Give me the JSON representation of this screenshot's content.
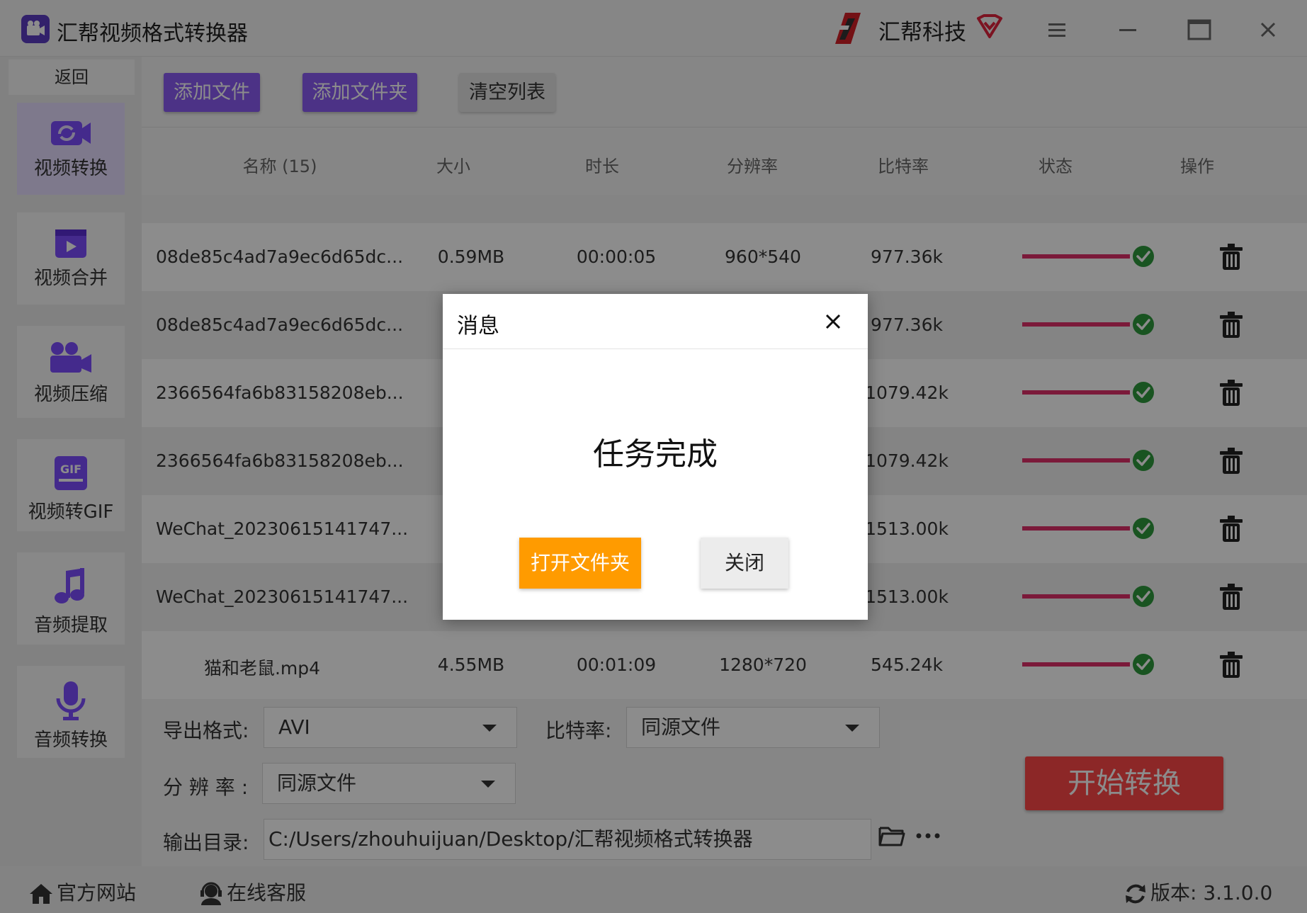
{
  "window": {
    "title": "汇帮视频格式转换器",
    "brand": "汇帮科技",
    "icons": [
      "app-logo-icon",
      "brand-logo-icon",
      "vip-icon",
      "menu-icon",
      "minimize-icon",
      "maximize-icon",
      "close-icon"
    ]
  },
  "sidebar": {
    "back_label": "返回",
    "items": [
      {
        "label": "视频转换",
        "icon": "video-convert-icon",
        "active": true
      },
      {
        "label": "视频合并",
        "icon": "video-merge-icon",
        "active": false
      },
      {
        "label": "视频压缩",
        "icon": "video-compress-icon",
        "active": false
      },
      {
        "label": "视频转GIF",
        "icon": "gif-icon",
        "active": false
      },
      {
        "label": "音频提取",
        "icon": "music-note-icon",
        "active": false
      },
      {
        "label": "音频转换",
        "icon": "microphone-icon",
        "active": false
      }
    ]
  },
  "toolbar": {
    "add_file": "添加文件",
    "add_folder": "添加文件夹",
    "clear_list": "清空列表"
  },
  "table": {
    "headers": {
      "name": "名称 (15)",
      "size": "大小",
      "duration": "时长",
      "resolution": "分辨率",
      "bitrate": "比特率",
      "status": "状态",
      "action": "操作"
    },
    "rows": [
      {
        "name": "08de85c4ad7a9ec6d65dc...",
        "size": "0.59MB",
        "duration": "00:00:05",
        "resolution": "960*540",
        "bitrate": "977.36k",
        "progress": 1.0
      },
      {
        "name": "08de85c4ad7a9ec6d65dc...",
        "size": "",
        "duration": "",
        "resolution": "",
        "bitrate": "977.36k",
        "progress": 1.0
      },
      {
        "name": "2366564fa6b83158208eb...",
        "size": "",
        "duration": "",
        "resolution": "",
        "bitrate": "1079.42k",
        "progress": 1.0
      },
      {
        "name": "2366564fa6b83158208eb...",
        "size": "",
        "duration": "",
        "resolution": "",
        "bitrate": "1079.42k",
        "progress": 1.0
      },
      {
        "name": "WeChat_20230615141747...",
        "size": "",
        "duration": "",
        "resolution": "",
        "bitrate": "1513.00k",
        "progress": 1.0
      },
      {
        "name": "WeChat_20230615141747...",
        "size": "",
        "duration": "",
        "resolution": "",
        "bitrate": "1513.00k",
        "progress": 1.0
      },
      {
        "name": "猫和老鼠.mp4",
        "size": "4.55MB",
        "duration": "00:01:09",
        "resolution": "1280*720",
        "bitrate": "545.24k",
        "progress": 1.0
      }
    ]
  },
  "settings": {
    "format_label": "导出格式:",
    "format_value": "AVI",
    "bitrate_label": "比特率:",
    "bitrate_value": "同源文件",
    "resolution_label": "分 辨 率 :",
    "resolution_value": "同源文件",
    "output_label": "输出目录:",
    "output_path": "C:/Users/zhouhuijuan/Desktop/汇帮视频格式转换器",
    "start_button": "开始转换"
  },
  "statusbar": {
    "website": "官方网站",
    "support": "在线客服",
    "version": "版本: 3.1.0.0"
  },
  "dialog": {
    "title": "消息",
    "message": "任务完成",
    "open_folder": "打开文件夹",
    "close": "关闭"
  },
  "colors": {
    "accent_purple": "#8a5cf5",
    "start_red": "#ff4747",
    "progress_pink": "#e0306a",
    "check_green": "#2e9a3c",
    "dialog_orange": "#ff9b00"
  }
}
